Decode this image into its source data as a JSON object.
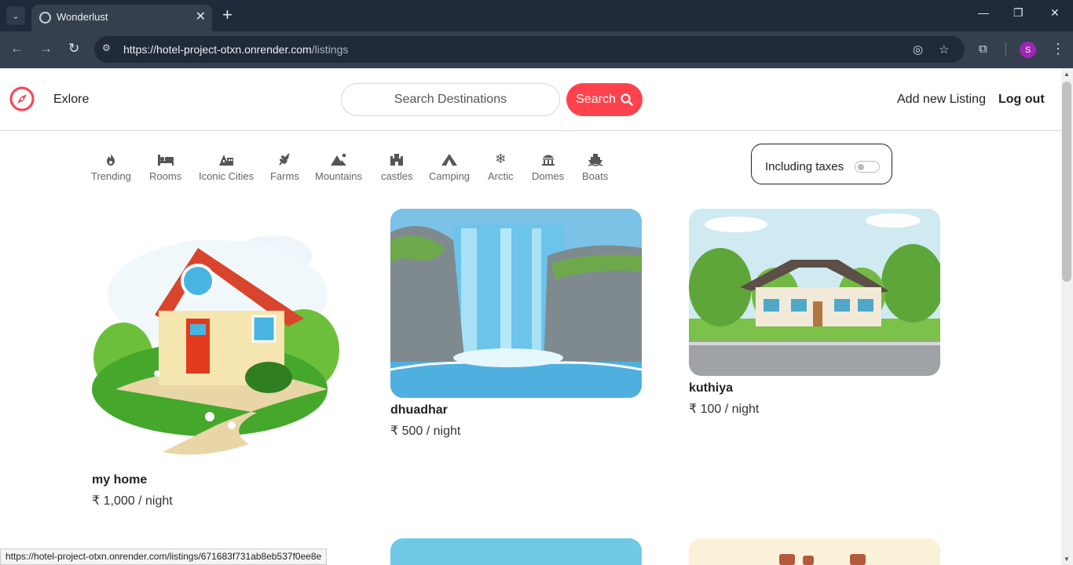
{
  "browser": {
    "tab_title": "Wonderlust",
    "url_host": "https://hotel-project-otxn.onrender.com",
    "url_path": "/listings",
    "profile_initial": "S",
    "status_url": "https://hotel-project-otxn.onrender.com/listings/671683f731ab8eb537f0ee8e"
  },
  "navbar": {
    "explore_label": "Exlore",
    "search_placeholder": "Search  Destinations",
    "search_button": "Search",
    "add_listing": "Add new Listing",
    "logout": "Log out",
    "accent": "#fe424d"
  },
  "filters": [
    {
      "label": "Trending",
      "icon": "fire-icon"
    },
    {
      "label": "Rooms",
      "icon": "bed-icon"
    },
    {
      "label": "Iconic Cities",
      "icon": "city-icon"
    },
    {
      "label": "Farms",
      "icon": "wheat-icon"
    },
    {
      "label": "Mountains",
      "icon": "mountain-icon"
    },
    {
      "label": "castles",
      "icon": "castle-icon"
    },
    {
      "label": "Camping",
      "icon": "tent-icon"
    },
    {
      "label": "Arctic",
      "icon": "snowflake-icon"
    },
    {
      "label": "Domes",
      "icon": "dome-icon"
    },
    {
      "label": "Boats",
      "icon": "ship-icon"
    }
  ],
  "taxes_toggle": {
    "label": "Including taxes",
    "checked": false
  },
  "listings": [
    {
      "title": "my home",
      "price": "₹ 1,000 / night"
    },
    {
      "title": "dhuadhar",
      "price": "₹ 500 / night"
    },
    {
      "title": "kuthiya",
      "price": "₹ 100 / night"
    }
  ]
}
